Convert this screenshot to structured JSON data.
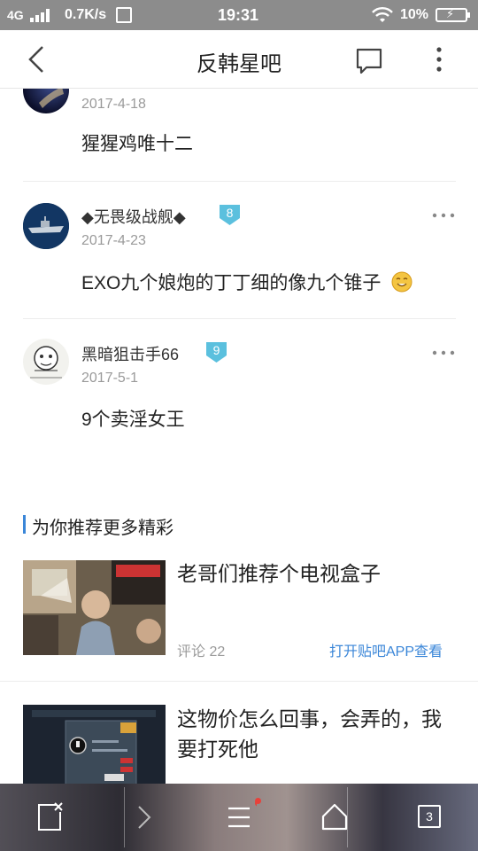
{
  "status_bar": {
    "network": "4G",
    "speed": "0.7K/s",
    "time": "19:31",
    "battery": "10%"
  },
  "nav": {
    "title": "反韩星吧"
  },
  "comments": [
    {
      "user": "",
      "date": "2017-4-18",
      "text": "猩猩鸡唯十二"
    },
    {
      "user": "◆无畏级战舰◆",
      "level": "8",
      "date": "2017-4-23",
      "text": "EXO九个娘炮的丁丁细的像九个锥子"
    },
    {
      "user": "黑暗狙击手66",
      "level": "9",
      "date": "2017-5-1",
      "text": "9个卖淫女王"
    }
  ],
  "recommend": {
    "header": "为你推荐更多精彩",
    "items": [
      {
        "title": "老哥们推荐个电视盒子",
        "comments": "评论  22",
        "open_app": "打开贴吧APP查看"
      },
      {
        "title": "这物价怎么回事，会弄的，我要打死他"
      }
    ]
  },
  "toolbar": {
    "tabs_count": "3"
  },
  "colors": {
    "accent": "#3a86d8",
    "level_badge": "#5bc0de",
    "status_bar": "#8c8c8c"
  }
}
